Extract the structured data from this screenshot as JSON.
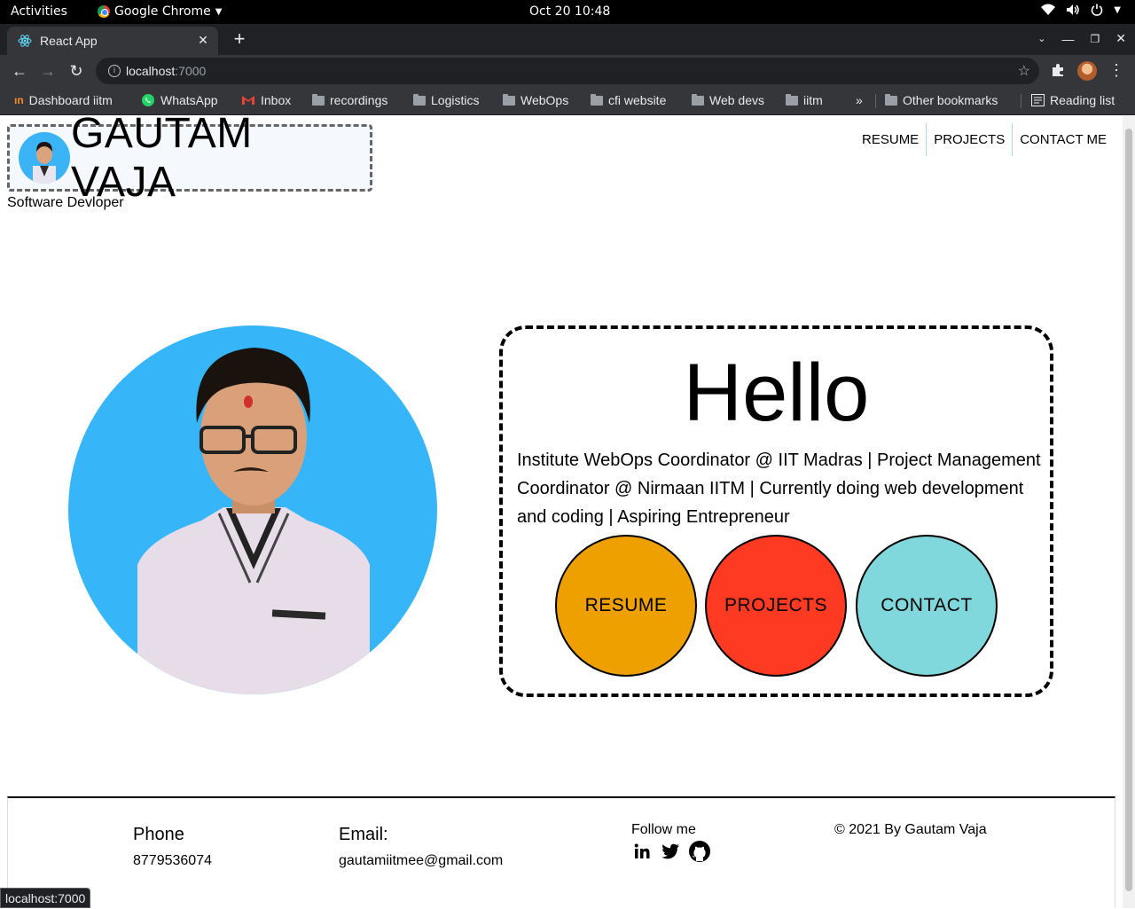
{
  "os_bar": {
    "activities": "Activities",
    "app_name": "Google Chrome",
    "clock": "Oct 20  10:48"
  },
  "browser": {
    "tab_title": "React App",
    "url_host": "localhost",
    "url_port": ":7000",
    "status_url": "localhost:7000",
    "bookmarks": [
      {
        "label": "Dashboard iitm",
        "icon": "iitm-icon"
      },
      {
        "label": "WhatsApp",
        "icon": "whatsapp-icon"
      },
      {
        "label": "Inbox",
        "icon": "gmail-icon"
      },
      {
        "label": "recordings",
        "icon": "folder-icon"
      },
      {
        "label": "Logistics",
        "icon": "folder-icon"
      },
      {
        "label": "WebOps",
        "icon": "folder-icon"
      },
      {
        "label": "cfi website",
        "icon": "folder-icon"
      },
      {
        "label": "Web devs",
        "icon": "folder-icon"
      },
      {
        "label": "iitm",
        "icon": "folder-icon"
      }
    ],
    "overflow": "»",
    "other_bookmarks": "Other bookmarks",
    "reading_list": "Reading list"
  },
  "page": {
    "brand_title": "GAUTAM VAJA",
    "tagline": "Software Devloper",
    "nav": [
      "RESUME",
      "PROJECTS",
      "CONTACT ME"
    ],
    "hello": "Hello",
    "bio": "Institute WebOps Coordinator @ IIT Madras | Project Management Coordinator @ Nirmaan IITM | Currently doing web development and coding | Aspiring Entrepreneur",
    "buttons": [
      {
        "label": "RESUME",
        "color": "#eea000"
      },
      {
        "label": "PROJECTS",
        "color": "#ff3a22"
      },
      {
        "label": "CONTACT",
        "color": "#80d8dc"
      }
    ],
    "footer": {
      "phone_label": "Phone",
      "phone_value": "8779536074",
      "email_label": "Email:",
      "email_value": "gautamiitmee@gmail.com",
      "follow_label": "Follow me",
      "copyright": "© 2021 By Gautam Vaja",
      "social_icons": [
        "linkedin-icon",
        "twitter-icon",
        "github-icon"
      ]
    }
  }
}
